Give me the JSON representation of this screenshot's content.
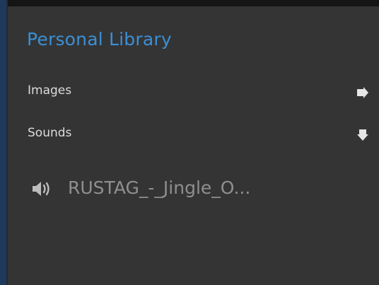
{
  "library": {
    "title": "Personal Library",
    "categories": [
      {
        "label": "Images",
        "icon": "arrow-right-icon"
      },
      {
        "label": "Sounds",
        "icon": "arrow-down-icon"
      }
    ],
    "sounds": [
      {
        "name": "RUSTAG_-_Jingle_O...",
        "icon": "speaker-icon"
      }
    ]
  },
  "colors": {
    "background": "#343434",
    "title": "#3b8fd6",
    "accent": "#1d3a5c",
    "text": "#dcdcdc",
    "muted_text": "#8f8f8f"
  }
}
